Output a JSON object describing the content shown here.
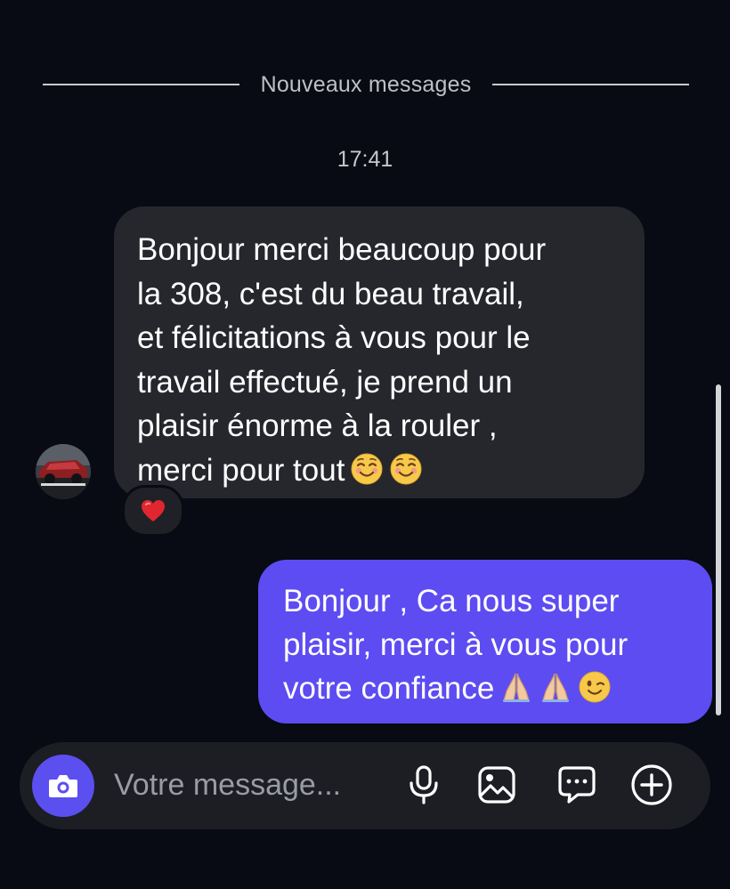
{
  "divider": {
    "label": "Nouveaux messages"
  },
  "conversation": {
    "timestamp": "17:41",
    "incoming": {
      "lines": [
        "Bonjour merci beaucoup pour",
        "la 308, c'est du beau travail,",
        "et félicitations à vous pour le",
        "travail effectué, je prend un",
        "plaisir énorme à la rouler ,",
        "merci pour tout"
      ],
      "emojis": [
        "smiling-face-emoji",
        "smiling-face-emoji"
      ],
      "reaction": "heart-reaction"
    },
    "outgoing": {
      "lines": [
        "Bonjour , Ca nous super",
        "plaisir, merci à vous pour",
        "votre confiance"
      ],
      "emojis": [
        "folded-hands-emoji",
        "folded-hands-emoji",
        "winking-face-emoji"
      ]
    }
  },
  "composer": {
    "placeholder": "Votre message...",
    "icons": [
      "camera-icon",
      "microphone-icon",
      "gallery-icon",
      "sticker-icon",
      "add-icon"
    ]
  },
  "colors": {
    "background": "#080a14",
    "incoming_bubble": "#25272d",
    "outgoing_bubble": "#5d4cf2",
    "accent": "#5b4ff0"
  }
}
